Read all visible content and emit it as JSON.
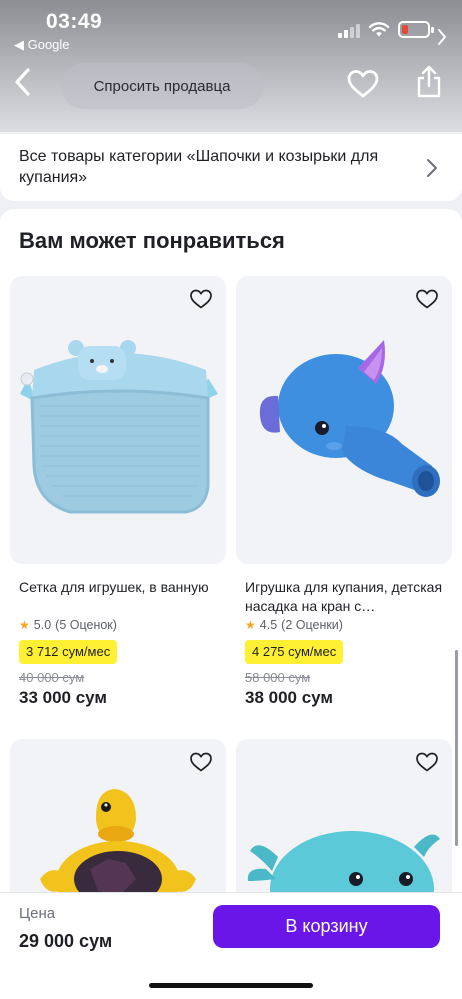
{
  "status": {
    "time": "03:49",
    "back_app": "◀ Google"
  },
  "nav": {
    "ask_seller": "Спросить продавца"
  },
  "category_link": {
    "text": "Все товары категории «Шапочки и козырьки для купания»"
  },
  "recommendations": {
    "title": "Вам может понравиться",
    "products": [
      {
        "name": "Сетка для игрушек, в ванную",
        "rating": "5.0",
        "reviews": "(5 Оценок)",
        "installment": "3 712 сум/мес",
        "old_price": "40 000 сум",
        "price": "33 000 сум",
        "image": "bath-toy-mesh-bag"
      },
      {
        "name": "Игрушка для купания, детская насадка на кран с…",
        "rating": "4.5",
        "reviews": "(2 Оценки)",
        "installment": "4 275 сум/мес",
        "old_price": "58 000 сум",
        "price": "38 000 сум",
        "image": "elephant-faucet-extender"
      },
      {
        "image": "turtle-bath-toy"
      },
      {
        "image": "whale-bath-toy"
      }
    ]
  },
  "bottom_bar": {
    "price_label": "Цена",
    "price": "29 000 сум",
    "cart_button": "В корзину"
  },
  "colors": {
    "accent": "#6a16e8",
    "installment_badge": "#fff033",
    "star": "#f5a623"
  }
}
